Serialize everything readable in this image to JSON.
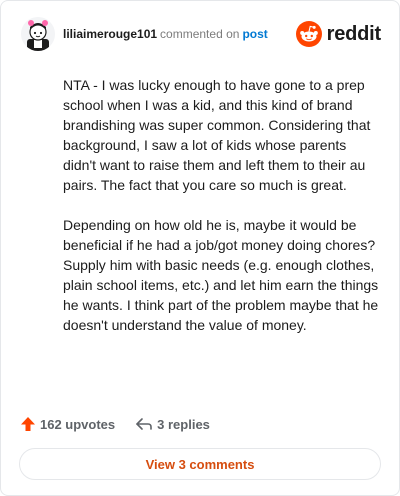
{
  "header": {
    "username": "liliaimerouge101",
    "action_text": "commented on",
    "post_link": "post"
  },
  "brand": {
    "wordmark": "reddit",
    "icon": "reddit-logo-icon",
    "color": "#ff4500"
  },
  "comment": {
    "paragraphs": [
      "NTA - I was lucky enough to have gone to a prep school when I was a kid, and this kind of brand brandishing was super common. Considering that background, I saw a lot of kids whose parents didn't want to raise them and left them to their au pairs. The fact that you care so much is great.",
      "Depending on how old he is, maybe it would be beneficial if he had a job/got money doing chores? Supply him with basic needs (e.g. enough clothes, plain school items, etc.) and let him earn the things he wants. I think part of the problem maybe that he doesn't understand the value of money."
    ]
  },
  "actions": {
    "upvotes_label": "162 upvotes",
    "upvote_icon": "upvote-arrow-icon",
    "upvote_color": "#ff4500",
    "replies_label": "3 replies",
    "reply_icon": "reply-arrow-icon"
  },
  "footer": {
    "view_comments_label": "View 3 comments",
    "accent_color": "#d64d0f"
  }
}
